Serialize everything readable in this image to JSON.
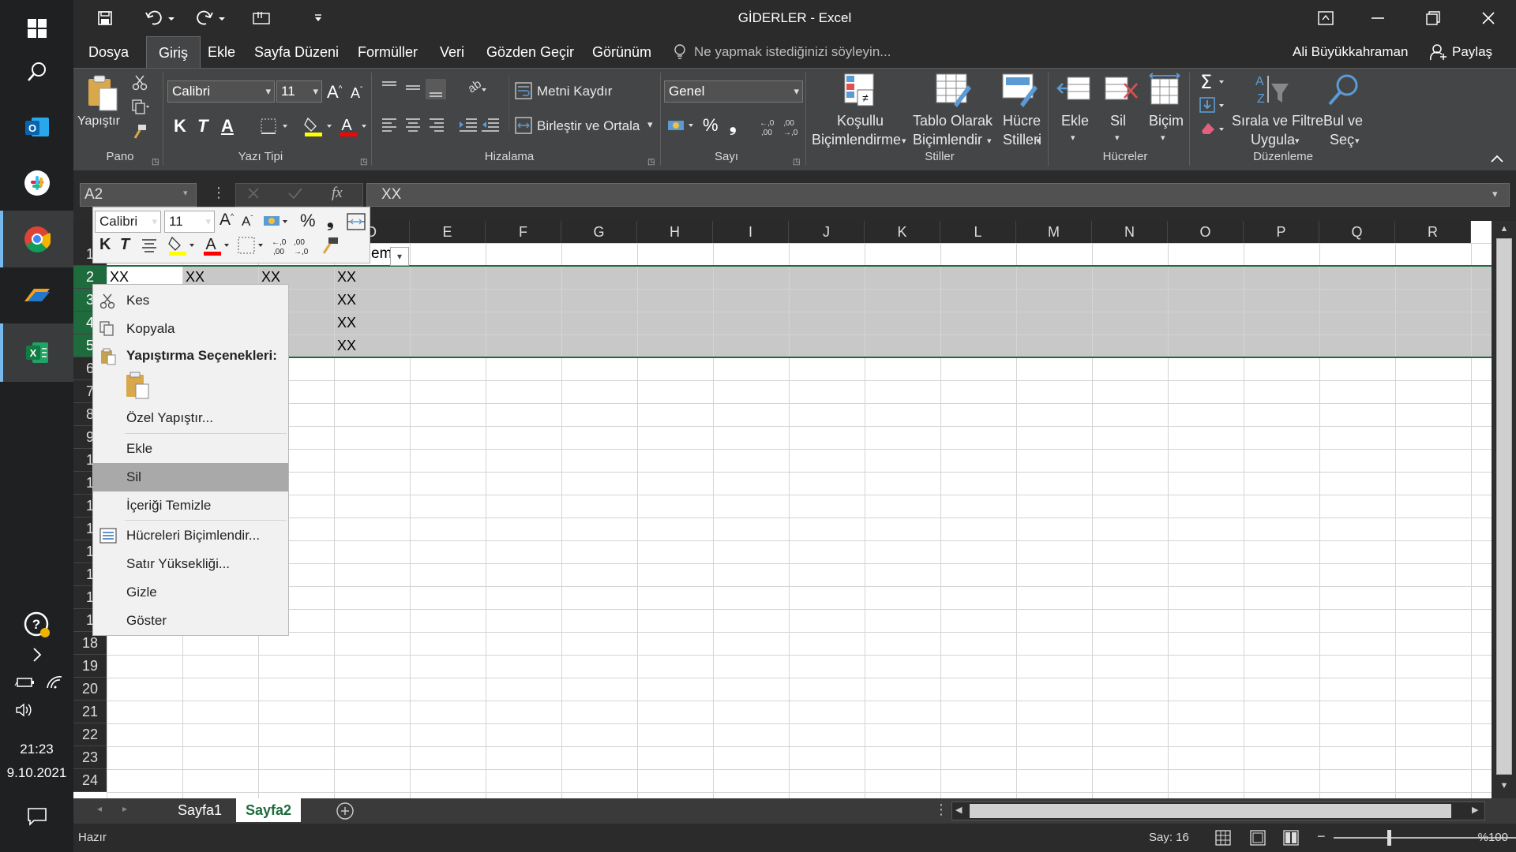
{
  "app": {
    "title": "GİDERLER - Excel",
    "user": "Ali Büyükkahraman",
    "share": "Paylaş"
  },
  "menu": {
    "tabs": [
      "Dosya",
      "Giriş",
      "Ekle",
      "Sayfa Düzeni",
      "Formüller",
      "Veri",
      "Gözden Geçir",
      "Görünüm"
    ],
    "active": "Giriş",
    "tell_me": "Ne yapmak istediğinizi söyleyin..."
  },
  "ribbon": {
    "paste": "Yapıştır",
    "font_name": "Calibri",
    "font_size": "11",
    "bold": "K",
    "italic": "T",
    "underline": "A",
    "wrap_text": "Metni Kaydır",
    "merge_center": "Birleştir ve Ortala",
    "number_format": "Genel",
    "percent": "%",
    "comma": "❟",
    "cond_format": [
      "Koşullu",
      "Biçimlendirme"
    ],
    "format_table": [
      "Tablo Olarak",
      "Biçimlendir"
    ],
    "cell_styles": [
      "Hücre",
      "Stilleri"
    ],
    "insert": "Ekle",
    "delete": "Sil",
    "format": "Biçim",
    "sort_filter": [
      "Sırala ve Filtre",
      "Uygula"
    ],
    "find_select": [
      "Bul ve",
      "Seç"
    ],
    "groups": {
      "clipboard": "Pano",
      "font": "Yazı Tipi",
      "alignment": "Hizalama",
      "number": "Sayı",
      "styles": "Stiller",
      "cells": "Hücreler",
      "editing": "Düzenleme"
    }
  },
  "formula": {
    "name_box": "A2",
    "value": "XX",
    "fx": "fx"
  },
  "grid": {
    "columns": [
      "A",
      "B",
      "C",
      "D",
      "E",
      "F",
      "G",
      "H",
      "I",
      "J",
      "K",
      "L",
      "M",
      "N",
      "O",
      "P",
      "Q",
      "R"
    ],
    "rows": [
      "1",
      "2",
      "3",
      "4",
      "5",
      "6",
      "7",
      "8",
      "9",
      "10",
      "11",
      "12",
      "13",
      "14",
      "15",
      "16",
      "17",
      "18",
      "19",
      "20",
      "21",
      "22",
      "23",
      "24"
    ],
    "row_labels_visible": [
      "1",
      "2",
      "3",
      "4",
      "5",
      "6",
      "7",
      "8",
      "9",
      "1",
      "1",
      "1",
      "1",
      "1",
      "1",
      "1",
      "1",
      "18",
      "19",
      "20",
      "21",
      "22",
      "23",
      "24"
    ],
    "header_fragment": "em",
    "cells": {
      "A2": "XX",
      "B2": "XX",
      "C2": "XX",
      "D2": "XX",
      "D3": "XX",
      "D4": "XX",
      "D5": "XX"
    }
  },
  "mini_toolbar": {
    "font_name": "Calibri",
    "font_size": "11",
    "percent": "%",
    "comma": "❟"
  },
  "context_menu": {
    "items": [
      "Kes",
      "Kopyala",
      "Yapıştırma Seçenekleri:",
      "Özel Yapıştır...",
      "Ekle",
      "Sil",
      "İçeriği Temizle",
      "Hücreleri Biçimlendir...",
      "Satır Yüksekliği...",
      "Gizle",
      "Göster"
    ],
    "highlighted": "Sil"
  },
  "sheets": {
    "tabs": [
      "Sayfa1",
      "Sayfa2"
    ],
    "active": "Sayfa2"
  },
  "status": {
    "ready": "Hazır",
    "count": "Say: 16",
    "zoom": "%100"
  },
  "taskbar": {
    "time": "21:23",
    "date": "9.10.2021"
  },
  "colors": {
    "excel_green": "#1e6b3d",
    "ribbon_bg": "#444546",
    "dark_bg": "#2b2b2b",
    "selection_gray": "#c8c8c8"
  }
}
